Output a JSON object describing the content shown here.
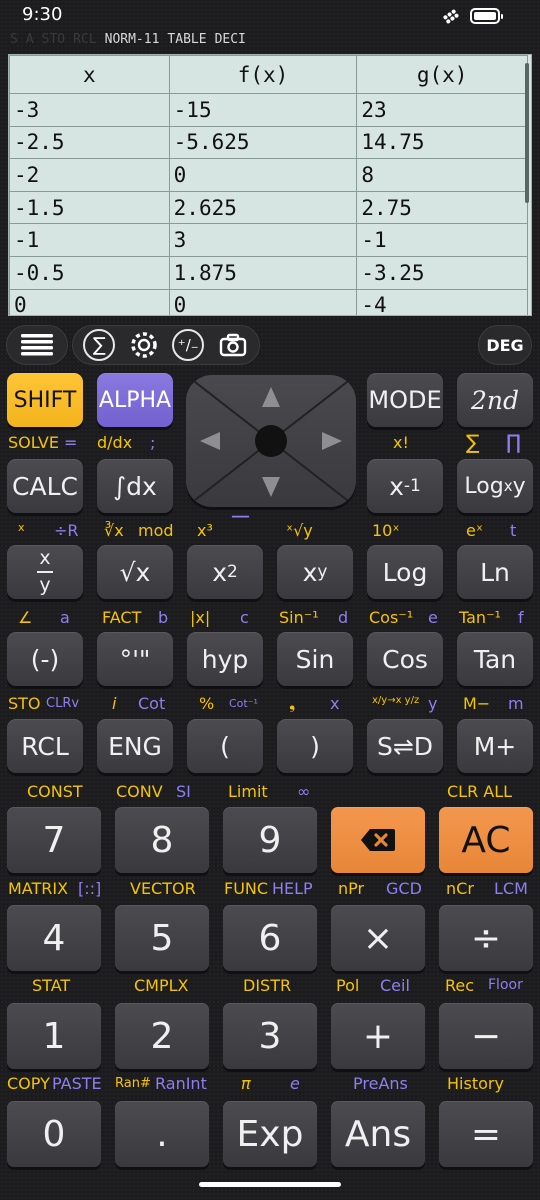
{
  "status": {
    "time": "9:30"
  },
  "indicators": [
    {
      "text": "S",
      "on": false
    },
    {
      "text": "A",
      "on": false
    },
    {
      "text": "STO",
      "on": false
    },
    {
      "text": "RCL",
      "on": false
    },
    {
      "text": "NORM-11",
      "on": true
    },
    {
      "text": "TABLE",
      "on": true
    },
    {
      "text": "DECI",
      "on": true
    }
  ],
  "table": {
    "headers": [
      "x",
      "f(x)",
      "g(x)"
    ],
    "rows": [
      [
        "-3",
        "-15",
        "23"
      ],
      [
        "-2.5",
        "-5.625",
        "14.75"
      ],
      [
        "-2",
        "0",
        "8"
      ],
      [
        "-1.5",
        "2.625",
        "2.75"
      ],
      [
        "-1",
        "3",
        "-1"
      ],
      [
        "-0.5",
        "1.875",
        "-3.25"
      ],
      [
        "0",
        "0",
        "-4"
      ]
    ]
  },
  "toolbar": {
    "angle_mode": "DEG"
  },
  "keys": {
    "shift": "SHIFT",
    "alpha": "ALPHA",
    "mode": "MODE",
    "second": "2nd",
    "calc": "CALC",
    "integral": "∫dx",
    "inverse_x": "x",
    "inverse_exp": "-1",
    "log_base": "Log",
    "log_base_sub": "x",
    "log_base_y": "y",
    "fraction_top": "x",
    "fraction_bottom": "y",
    "sqrt": "√x",
    "square": "x",
    "square_exp": "2",
    "power": "x",
    "power_exp": "y",
    "log": "Log",
    "ln": "Ln",
    "neg": "(-)",
    "deg": "°'\"",
    "hyp": "hyp",
    "sin": "Sin",
    "cos": "Cos",
    "tan": "Tan",
    "rcl": "RCL",
    "eng": "ENG",
    "lparen": "(",
    "rparen": ")",
    "s_d": "S⇌D",
    "m_plus": "M+",
    "n7": "7",
    "n8": "8",
    "n9": "9",
    "del": "⌫",
    "ac": "AC",
    "n4": "4",
    "n5": "5",
    "n6": "6",
    "mul": "×",
    "div": "÷",
    "n1": "1",
    "n2": "2",
    "n3": "3",
    "add": "+",
    "sub": "−",
    "n0": "0",
    "dot": ".",
    "exp": "Exp",
    "ans": "Ans",
    "eq": "="
  },
  "labels": {
    "solve": "SOLVE",
    "solve_eq": "=",
    "ddx": "d/dx",
    "semicolon": ";",
    "xfact": "x!",
    "sigma": "∑",
    "pi_prod": "∏",
    "r2_a": "x",
    "r2_b": "÷R",
    "r2_c": "∛x",
    "r2_mod": "mod",
    "r2_cube": "x³",
    "r2_bar": "▔▔",
    "r2_root": "ˣ√y",
    "r2_ten": "10ˣ",
    "r2_ex": "eˣ",
    "r2_t": "t",
    "angle": "∠",
    "a": "a",
    "fact": "FACT",
    "b": "b",
    "abs": "|x|",
    "c": "c",
    "asin": "Sin⁻¹",
    "d": "d",
    "acos": "Cos⁻¹",
    "e": "e",
    "atan": "Tan⁻¹",
    "f": "f",
    "sto": "STO",
    "clrv": "CLRv",
    "i": "i",
    "cot": "Cot",
    "pct": "%",
    "acot": "Cot⁻¹",
    "comma": "❟",
    "x": "x",
    "conv_frac": "x/y→x y/z",
    "y": "y",
    "m_minus": "M−",
    "m": "m",
    "const": "CONST",
    "conv": "CONV",
    "si": "SI",
    "limit": "Limit",
    "inf": "∞",
    "clr_all": "CLR ALL",
    "matrix": "MATRIX",
    "vector": "VECTOR",
    "func": "FUNC",
    "help": "HELP",
    "npr": "nPr",
    "gcd": "GCD",
    "ncr": "nCr",
    "lcm": "LCM",
    "stat": "STAT",
    "cmplx": "CMPLX",
    "distr": "DISTR",
    "pol": "Pol",
    "ceil": "Ceil",
    "rec": "Rec",
    "floor": "Floor",
    "copy": "COPY",
    "paste": "PASTE",
    "ran": "Ran#",
    "ranint": "RanInt",
    "pi": "π",
    "e_const": "e",
    "preans": "PreAns",
    "history": "History"
  }
}
